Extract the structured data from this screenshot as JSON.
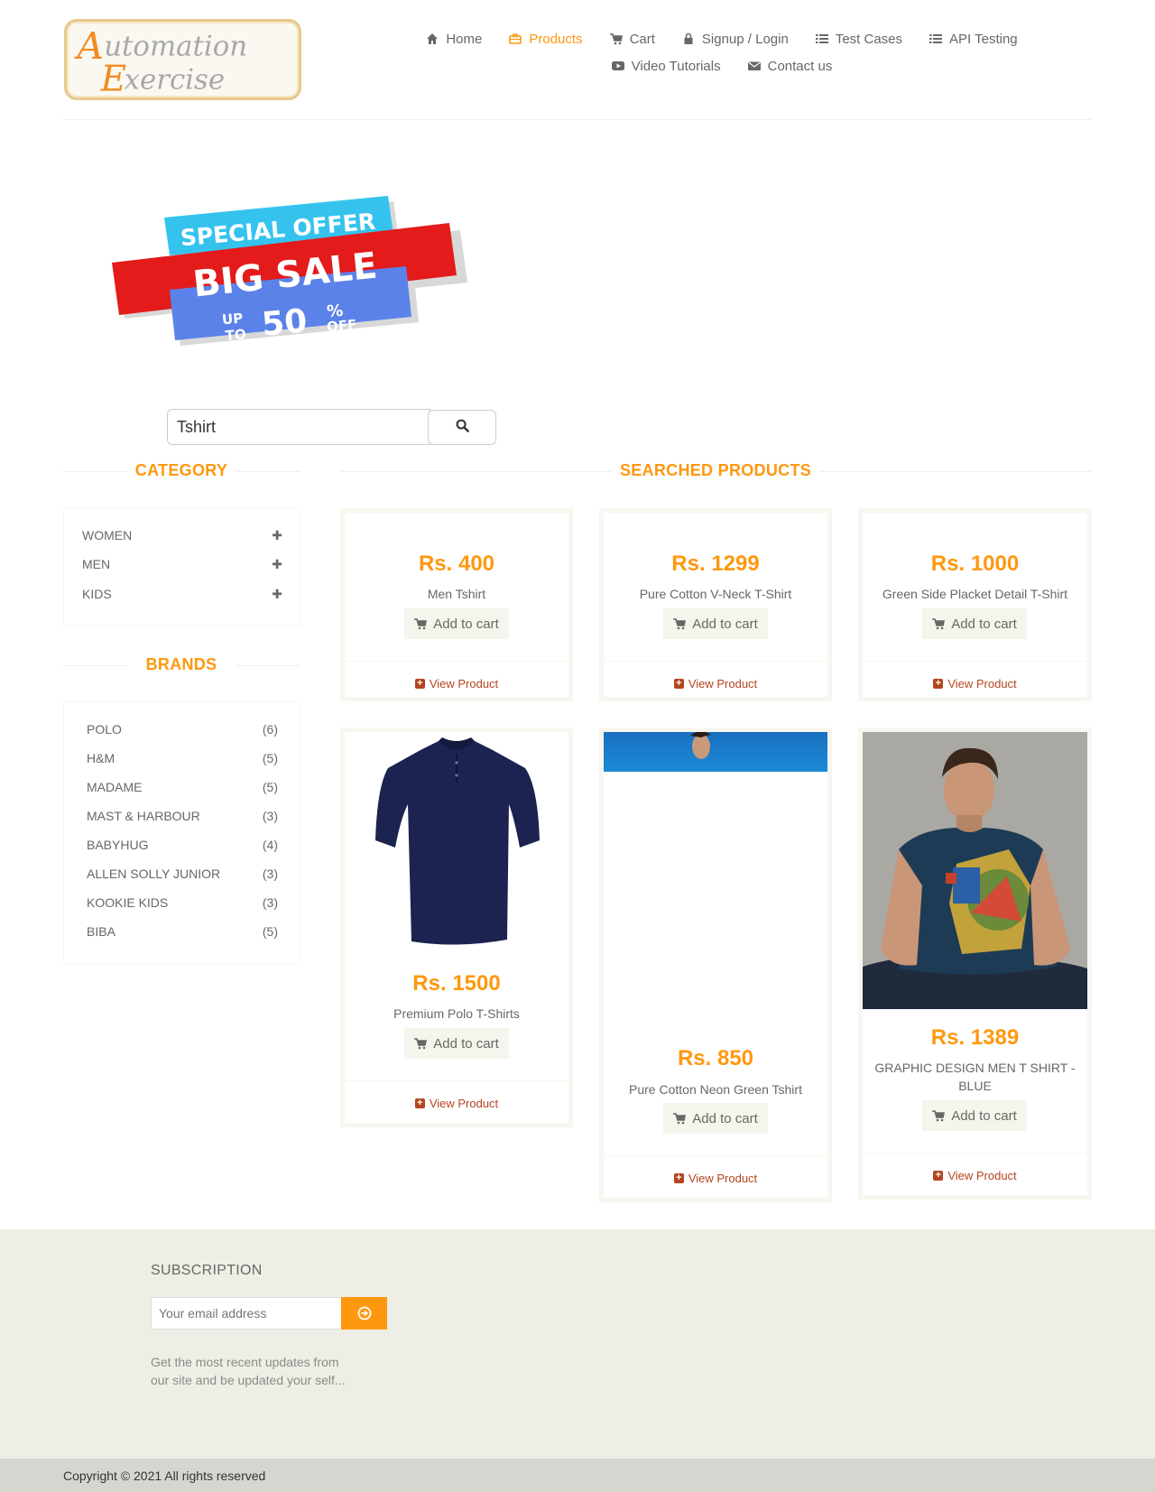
{
  "brand": {
    "logo_text_line1": "Automation",
    "logo_text_line2": "Exercise"
  },
  "nav": {
    "items": [
      {
        "label": "Home",
        "icon": "home-icon"
      },
      {
        "label": "Products",
        "icon": "briefcase-icon",
        "active": true
      },
      {
        "label": "Cart",
        "icon": "cart-icon"
      },
      {
        "label": "Signup / Login",
        "icon": "lock-icon"
      },
      {
        "label": "Test Cases",
        "icon": "list-icon"
      },
      {
        "label": "API Testing",
        "icon": "list-icon"
      },
      {
        "label": "Video Tutorials",
        "icon": "youtube-icon"
      },
      {
        "label": "Contact us",
        "icon": "envelope-icon"
      }
    ]
  },
  "banner": {
    "line1": "SPECIAL OFFER",
    "line2": "BIG SALE",
    "line3_up": "UP",
    "line3_to": "TO",
    "line3_pct": "50",
    "line3_percent": "%",
    "line3_off": "OFF"
  },
  "search": {
    "value": "Tshirt",
    "button_icon": "search-icon"
  },
  "category": {
    "title": "CATEGORY",
    "items": [
      {
        "label": "WOMEN"
      },
      {
        "label": "MEN"
      },
      {
        "label": "KIDS"
      }
    ]
  },
  "brands": {
    "title": "BRANDS",
    "items": [
      {
        "name": "POLO",
        "count": "(6)"
      },
      {
        "name": "H&M",
        "count": "(5)"
      },
      {
        "name": "MADAME",
        "count": "(5)"
      },
      {
        "name": "MAST & HARBOUR",
        "count": "(3)"
      },
      {
        "name": "BABYHUG",
        "count": "(4)"
      },
      {
        "name": "ALLEN SOLLY JUNIOR",
        "count": "(3)"
      },
      {
        "name": "KOOKIE KIDS",
        "count": "(3)"
      },
      {
        "name": "BIBA",
        "count": "(5)"
      }
    ]
  },
  "products": {
    "title": "SEARCHED PRODUCTS",
    "add_label": "Add to cart",
    "view_label": "View Product",
    "items": [
      {
        "price": "Rs. 400",
        "name": "Men Tshirt"
      },
      {
        "price": "Rs. 1299",
        "name": "Pure Cotton V-Neck T-Shirt"
      },
      {
        "price": "Rs. 1000",
        "name": "Green Side Placket Detail T-Shirt"
      },
      {
        "price": "Rs. 1500",
        "name": "Premium Polo T-Shirts"
      },
      {
        "price": "Rs. 850",
        "name": "Pure Cotton Neon Green Tshirt"
      },
      {
        "price": "Rs. 1389",
        "name": "GRAPHIC DESIGN MEN T SHIRT - BLUE"
      }
    ]
  },
  "footer": {
    "subscription_title": "SUBSCRIPTION",
    "email_placeholder": "Your email address",
    "sub_text": "Get the most recent updates from our site and be updated your self...",
    "copyright": "Copyright © 2021 All rights reserved"
  },
  "colors": {
    "accent": "#fe980f",
    "link": "#b4451f",
    "footer_bg": "#eeeee6"
  }
}
